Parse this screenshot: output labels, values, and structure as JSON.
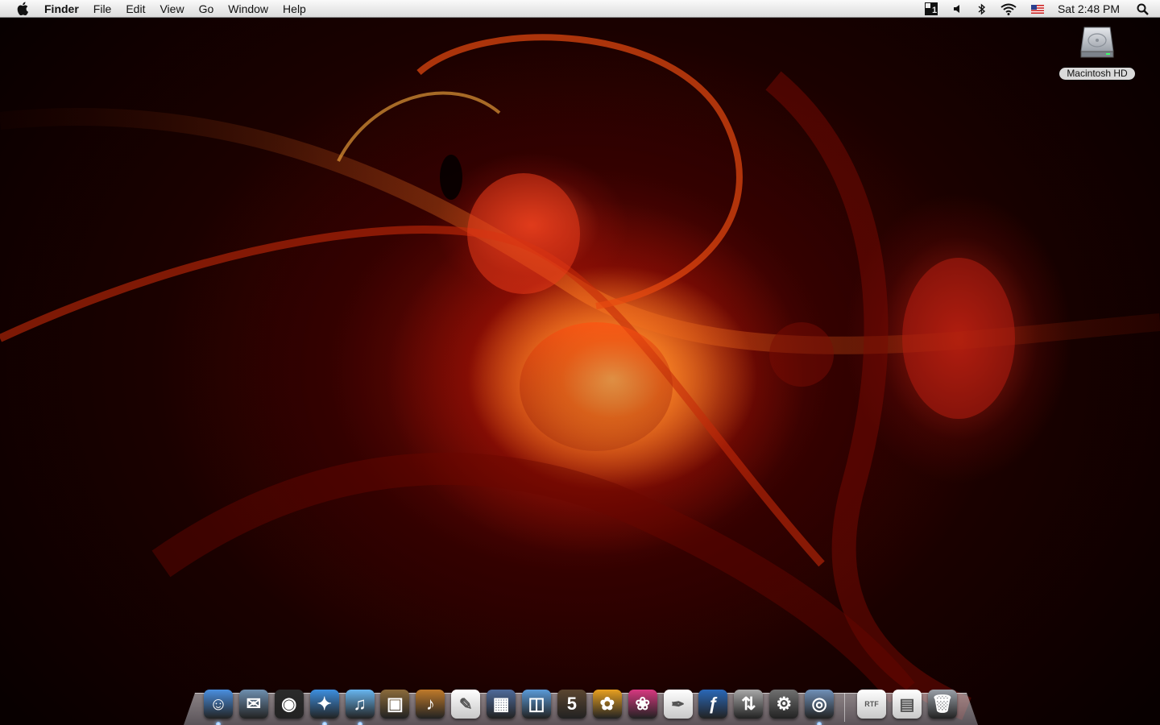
{
  "menubar": {
    "app_name": "Finder",
    "menus": [
      "File",
      "Edit",
      "View",
      "Go",
      "Window",
      "Help"
    ],
    "status_icons": [
      "spaces-icon",
      "volume-icon",
      "bluetooth-icon",
      "wifi-icon",
      "us-flag-icon"
    ],
    "clock": "Sat 2:48 PM"
  },
  "desktop": {
    "icons": [
      {
        "label": "Macintosh HD",
        "icon": "hard-drive-icon"
      }
    ]
  },
  "dock": {
    "apps": [
      {
        "name": "finder",
        "symbol": "☺",
        "color": "#4a8fe0",
        "running": true
      },
      {
        "name": "mail",
        "symbol": "✉",
        "color": "#6e8fb0",
        "running": false
      },
      {
        "name": "dashboard",
        "symbol": "◉",
        "color": "#2b2b2b",
        "running": false
      },
      {
        "name": "safari",
        "symbol": "✦",
        "color": "#3d8fe0",
        "running": true
      },
      {
        "name": "itunes",
        "symbol": "♫",
        "color": "#68b6f0",
        "running": true
      },
      {
        "name": "iphoto",
        "symbol": "▣",
        "color": "#8a6a3a",
        "running": false
      },
      {
        "name": "garageband",
        "symbol": "♪",
        "color": "#c07a2a",
        "running": false
      },
      {
        "name": "textedit",
        "symbol": "✎",
        "color": "#e8e8e8",
        "running": false
      },
      {
        "name": "expose",
        "symbol": "▦",
        "color": "#4e6a9a",
        "running": false
      },
      {
        "name": "preview",
        "symbol": "◫",
        "color": "#5a9ad8",
        "running": false
      },
      {
        "name": "logic-5",
        "symbol": "5",
        "color": "#5b4630",
        "running": false
      },
      {
        "name": "illustrator",
        "symbol": "✿",
        "color": "#e8a020",
        "running": false
      },
      {
        "name": "flower-app",
        "symbol": "❀",
        "color": "#d83880",
        "running": false
      },
      {
        "name": "pages",
        "symbol": "✒",
        "color": "#e0e0e0",
        "running": false
      },
      {
        "name": "flash",
        "symbol": "ƒ",
        "color": "#2a68b8",
        "running": false
      },
      {
        "name": "transmit",
        "symbol": "⇅",
        "color": "#a8a8a8",
        "running": false
      },
      {
        "name": "system-preferences",
        "symbol": "⚙",
        "color": "#707070",
        "running": false
      },
      {
        "name": "image-capture",
        "symbol": "◎",
        "color": "#7090b8",
        "running": true
      }
    ],
    "docs": [
      {
        "name": "rtf-document",
        "symbol": "RTF",
        "color": "#f0f0f0"
      },
      {
        "name": "document",
        "symbol": "▤",
        "color": "#f0f0f0"
      },
      {
        "name": "trash",
        "symbol": "🗑",
        "color": "#9aa0a8"
      }
    ]
  }
}
